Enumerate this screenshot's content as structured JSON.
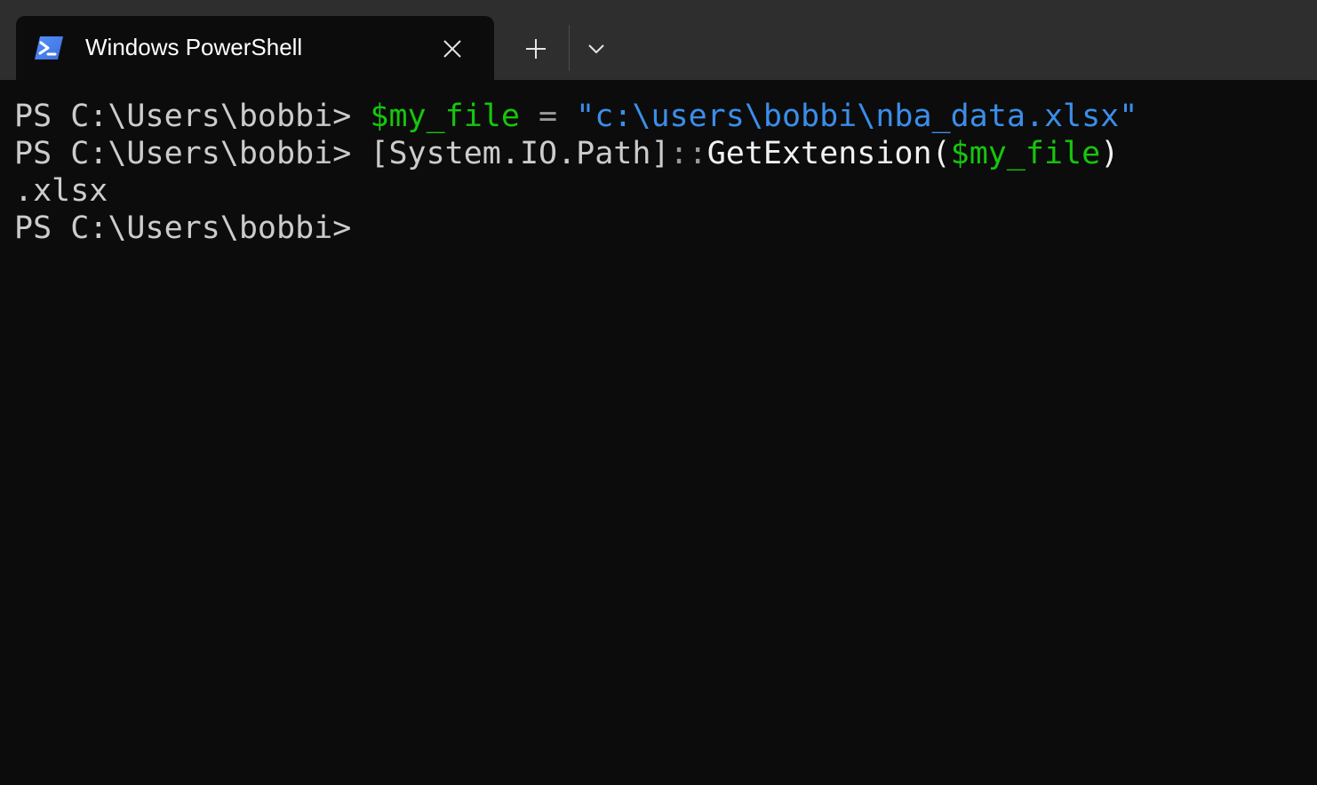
{
  "tab": {
    "title": "Windows PowerShell",
    "icon": "powershell-icon",
    "close_icon": "close-icon"
  },
  "toolbar": {
    "new_tab_icon": "plus-icon",
    "dropdown_icon": "chevron-down-icon"
  },
  "colors": {
    "titlebar_bg": "#2e2e2e",
    "console_bg": "#0c0c0c",
    "default_text": "#cccccc",
    "variable": "#16c60c",
    "string": "#3b8eea",
    "operator": "#9a9a9a"
  },
  "console": {
    "line1": {
      "prompt": "PS C:\\Users\\bobbi> ",
      "var": "$my_file",
      "op": " = ",
      "str": "\"c:\\users\\bobbi\\nba_data.xlsx\""
    },
    "line2": {
      "prompt": "PS C:\\Users\\bobbi> ",
      "type": "[System.IO.Path]",
      "sep": "::",
      "member": "GetExtension(",
      "var": "$my_file",
      "close": ")"
    },
    "line3": {
      "output": ".xlsx"
    },
    "line4": {
      "prompt": "PS C:\\Users\\bobbi>"
    }
  }
}
